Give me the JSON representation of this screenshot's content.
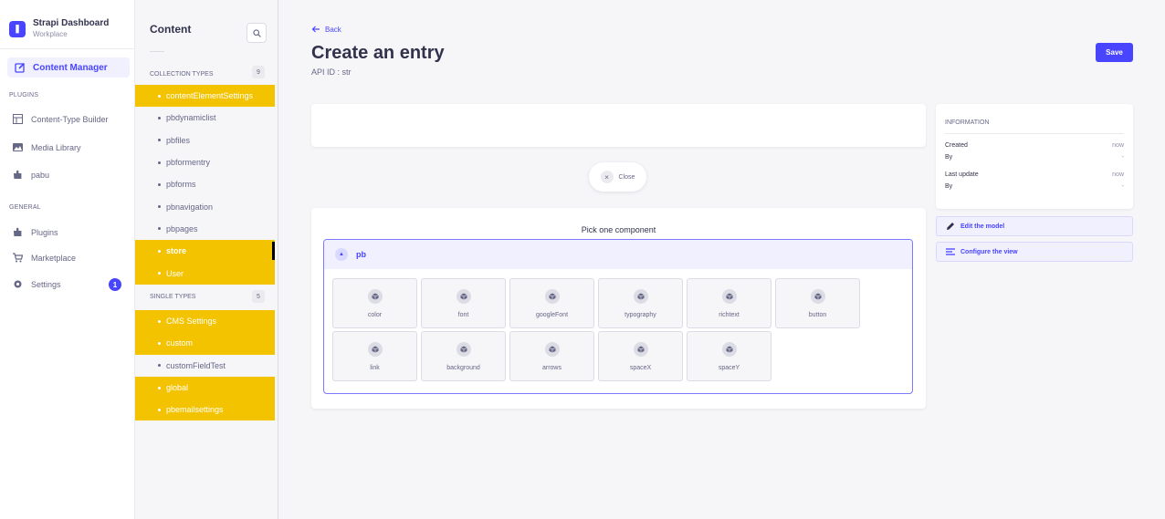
{
  "brand": {
    "title": "Strapi Dashboard",
    "subtitle": "Workplace",
    "logo_glyph": "❚"
  },
  "leftnav": {
    "active_item": "Content Manager",
    "plugins_label": "PLUGINS",
    "plugins": [
      "Content-Type Builder",
      "Media Library",
      "pabu"
    ],
    "general_label": "GENERAL",
    "general": [
      "Plugins",
      "Marketplace",
      "Settings"
    ],
    "settings_badge": "1"
  },
  "content_sidebar": {
    "title": "Content",
    "collection_label": "COLLECTION TYPES",
    "collection_count": "9",
    "collection_types": [
      {
        "label": "contentElementSettings",
        "highlighted": true,
        "active": false
      },
      {
        "label": "pbdynamiclist",
        "highlighted": false,
        "active": false
      },
      {
        "label": "pbfiles",
        "highlighted": false,
        "active": false
      },
      {
        "label": "pbformentry",
        "highlighted": false,
        "active": false
      },
      {
        "label": "pbforms",
        "highlighted": false,
        "active": false
      },
      {
        "label": "pbnavigation",
        "highlighted": false,
        "active": false
      },
      {
        "label": "pbpages",
        "highlighted": false,
        "active": false
      },
      {
        "label": "store",
        "highlighted": true,
        "active": true
      },
      {
        "label": "User",
        "highlighted": true,
        "active": false
      }
    ],
    "single_label": "SINGLE TYPES",
    "single_count": "5",
    "single_types": [
      {
        "label": "CMS Settings",
        "highlighted": true
      },
      {
        "label": "custom",
        "highlighted": true
      },
      {
        "label": "customFieldTest",
        "highlighted": false
      },
      {
        "label": "global",
        "highlighted": true
      },
      {
        "label": "pbemailsettings",
        "highlighted": true
      }
    ]
  },
  "header": {
    "back_label": "Back",
    "title": "Create an entry",
    "api_id": "API ID : str",
    "save_label": "Save"
  },
  "close_label": "Close",
  "picker": {
    "title": "Pick one component",
    "group_name": "pb",
    "components": [
      "color",
      "font",
      "googleFont",
      "typography",
      "richtext",
      "button",
      "link",
      "background",
      "arrows",
      "spaceX",
      "spaceY"
    ]
  },
  "information": {
    "title": "INFORMATION",
    "created_label": "Created",
    "created_value": "now",
    "created_by_label": "By",
    "created_by_value": "-",
    "updated_label": "Last update",
    "updated_value": "now",
    "updated_by_label": "By",
    "updated_by_value": "-"
  },
  "actions": {
    "edit_model": "Edit the model",
    "configure_view": "Configure the view"
  },
  "colors": {
    "accent": "#4945ff",
    "highlight": "#f3c300"
  }
}
